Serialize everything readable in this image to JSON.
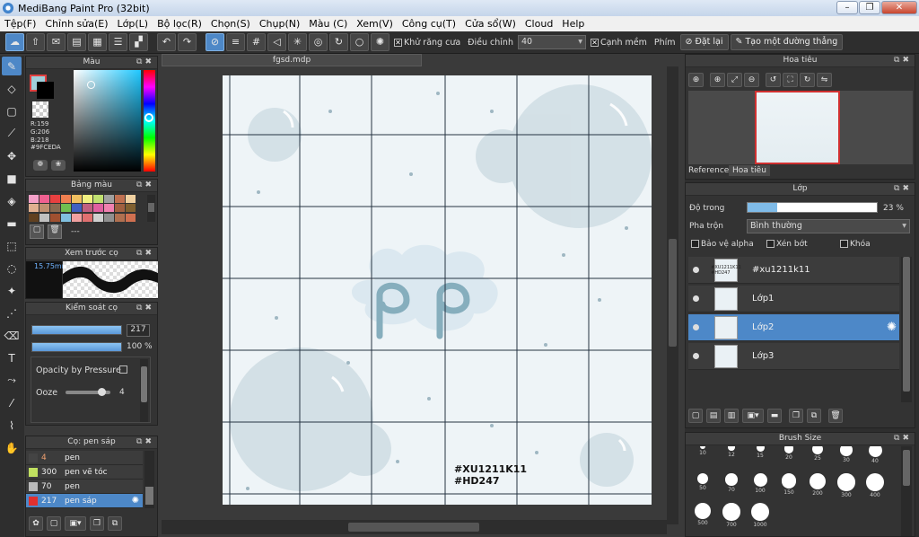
{
  "app": {
    "title": "MediBang Paint Pro (32bit)",
    "win_min": "–",
    "win_max": "❐",
    "win_close": "✕"
  },
  "menu": [
    "Tệp(F)",
    "Chỉnh sửa(E)",
    "Lớp(L)",
    "Bộ lọc(R)",
    "Chọn(S)",
    "Chụp(N)",
    "Màu (C)",
    "Xem(V)",
    "Công cụ(T)",
    "Cửa sổ(W)",
    "Cloud",
    "Help"
  ],
  "toolbar": {
    "antialias_label": "Khử răng cưa",
    "antialias_checked": "✕",
    "adjust_label": "Điều chỉnh",
    "adjust_value": "40",
    "snap_label": "Cạnh mềm",
    "snap_checked": "✕",
    "keys_label": "Phím",
    "reset_label": "Đặt lại",
    "ruler_label": "Tạo một đường thẳng"
  },
  "color_panel": {
    "title": "Màu",
    "r": "R:159",
    "g": "G:206",
    "b": "B:218",
    "hex": "#9FCEDA",
    "fg_color": "#9fceda"
  },
  "palette_panel": {
    "title": "Bảng màu",
    "name": "---",
    "swatches": [
      "#f4a0c8",
      "#f06090",
      "#e84040",
      "#f08050",
      "#f0c060",
      "#f0f080",
      "#c0e070",
      "#a0a0a0",
      "#c07050",
      "#f0d0a0",
      "#e0b090",
      "#c09070",
      "#8a6a50",
      "#70c050",
      "#4060c0",
      "#c06080",
      "#e060a0",
      "#f080b0",
      "#a06040",
      "#806030",
      "#604020",
      "#c0c0c0",
      "#a05030",
      "#80c0e0",
      "#f0a0a0",
      "#e07070",
      "#d0d0d0",
      "#909090",
      "#b07050",
      "#d07050"
    ]
  },
  "brush_preview": {
    "title": "Xem trước cọ",
    "size": "15.75mm"
  },
  "brush_control": {
    "title": "Kiểm soát cọ",
    "size_value": "217",
    "opacity_value": "100 %",
    "opacity_fraction": 1.0,
    "size_fraction": 1.0,
    "pressure_label": "Opacity by Pressure",
    "ooze_label": "Ooze",
    "ooze_value": "4"
  },
  "brush_list": {
    "title": "Cọ: pen sáp",
    "items": [
      {
        "size": "4",
        "name": "pen",
        "color": "#444"
      },
      {
        "size": "300",
        "name": "pen vẽ tóc",
        "color": "#c0e060"
      },
      {
        "size": "70",
        "name": "pen",
        "color": "#bbbbbb"
      },
      {
        "size": "217",
        "name": "pen sáp",
        "color": "#e03030"
      }
    ]
  },
  "document": {
    "tab": "fgsd.mdp",
    "watermark_line1": "#XU1211K11",
    "watermark_line2": "#HD247"
  },
  "navigator": {
    "title": "Hoa tiêu",
    "tab_reference": "Reference",
    "tab_navigator": "Hoa tiêu"
  },
  "layers": {
    "title": "Lớp",
    "opacity_label": "Độ trong",
    "opacity_value": "23 %",
    "opacity_fraction": 0.23,
    "blend_label": "Pha trộn",
    "blend_value": "Bình thường",
    "protect_alpha": "Bảo vệ alpha",
    "clipping": "Xén bớt",
    "lock": "Khóa",
    "items": [
      {
        "name": "#xu1211k11",
        "thumb": "#XU1211K11 #HD247"
      },
      {
        "name": "Lớp1",
        "thumb": ""
      },
      {
        "name": "Lớp2",
        "thumb": "",
        "selected": true
      },
      {
        "name": "Lớp3",
        "thumb": ""
      }
    ]
  },
  "brush_size": {
    "title": "Brush Size",
    "sizes": [
      "10",
      "12",
      "15",
      "20",
      "25",
      "30",
      "40",
      "50",
      "70",
      "100",
      "150",
      "200",
      "300",
      "400",
      "500",
      "700",
      "1000"
    ]
  }
}
